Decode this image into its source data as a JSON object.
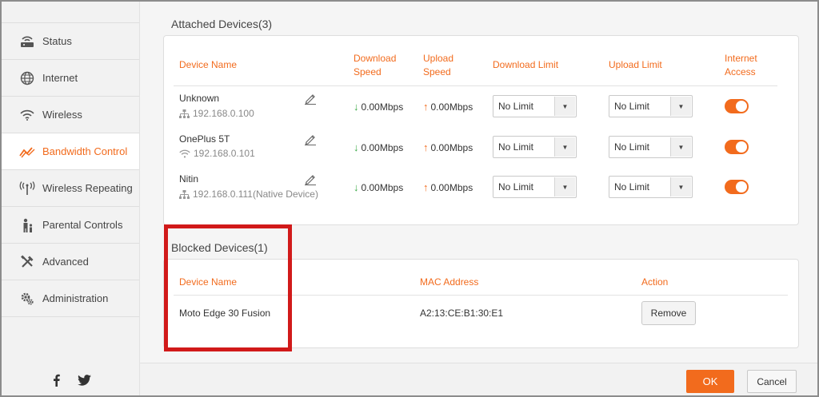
{
  "sidebar": {
    "items": [
      {
        "label": "Status",
        "icon": "router-icon",
        "active": false
      },
      {
        "label": "Internet",
        "icon": "globe-icon",
        "active": false
      },
      {
        "label": "Wireless",
        "icon": "wifi-icon",
        "active": false
      },
      {
        "label": "Bandwidth Control",
        "icon": "bandwidth-icon",
        "active": true
      },
      {
        "label": "Wireless Repeating",
        "icon": "antenna-icon",
        "active": false
      },
      {
        "label": "Parental Controls",
        "icon": "parent-child-icon",
        "active": false
      },
      {
        "label": "Advanced",
        "icon": "tools-icon",
        "active": false
      },
      {
        "label": "Administration",
        "icon": "gears-icon",
        "active": false
      }
    ],
    "social": [
      "facebook-icon",
      "twitter-icon"
    ]
  },
  "attached": {
    "title": "Attached Devices(3)",
    "headers": {
      "device_name": "Device Name",
      "download_speed_1": "Download",
      "download_speed_2": "Speed",
      "upload_speed_1": "Upload",
      "upload_speed_2": "Speed",
      "download_limit": "Download Limit",
      "upload_limit": "Upload Limit",
      "internet_access_1": "Internet",
      "internet_access_2": "Access"
    },
    "rows": [
      {
        "name": "Unknown",
        "conn_icon": "wired-icon",
        "ip": "192.168.0.100",
        "down": "0.00Mbps",
        "up": "0.00Mbps",
        "down_limit": "No Limit",
        "up_limit": "No Limit",
        "access": true
      },
      {
        "name": "OnePlus 5T",
        "conn_icon": "wifi-icon",
        "ip": "192.168.0.101",
        "down": "0.00Mbps",
        "up": "0.00Mbps",
        "down_limit": "No Limit",
        "up_limit": "No Limit",
        "access": true
      },
      {
        "name": "Nitin",
        "conn_icon": "wired-icon",
        "ip": "192.168.0.111(Native Device)",
        "down": "0.00Mbps",
        "up": "0.00Mbps",
        "down_limit": "No Limit",
        "up_limit": "No Limit",
        "access": true
      }
    ]
  },
  "blocked": {
    "title": "Blocked Devices(1)",
    "headers": {
      "device_name": "Device Name",
      "mac": "MAC Address",
      "action": "Action"
    },
    "rows": [
      {
        "name": "Moto Edge 30 Fusion",
        "mac": "A2:13:CE:B1:30:E1",
        "action_label": "Remove"
      }
    ]
  },
  "footer": {
    "ok_label": "OK",
    "cancel_label": "Cancel"
  },
  "colors": {
    "accent": "#f26b1d",
    "download_arrow": "#39a845",
    "highlight": "#d11a1a"
  }
}
